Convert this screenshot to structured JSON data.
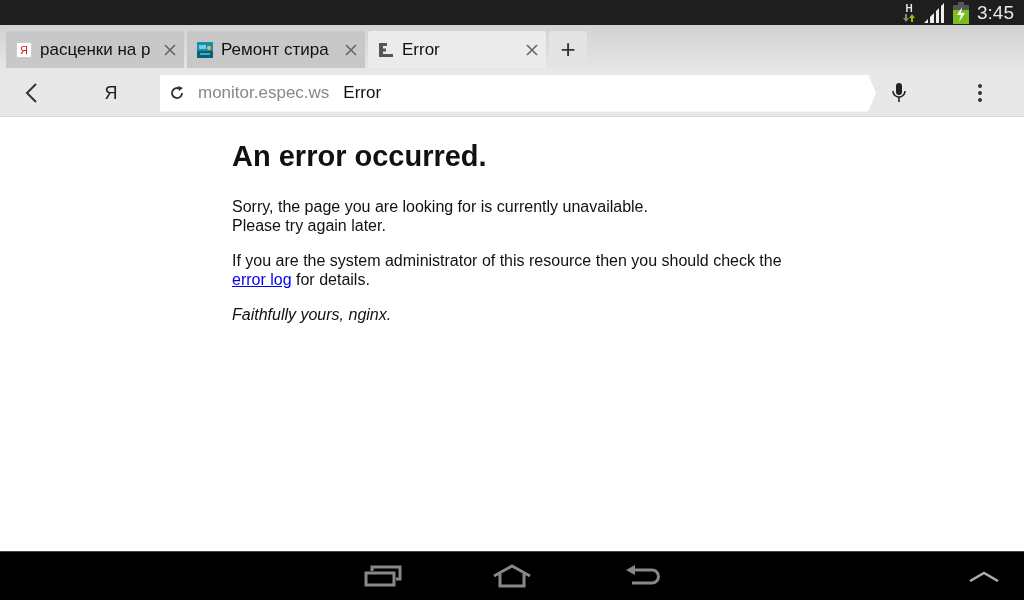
{
  "status_bar": {
    "network": "H",
    "time": "3:45"
  },
  "tabs": [
    {
      "label": "расценки на р",
      "kind": "letter",
      "icon_text": "Я",
      "selected": false
    },
    {
      "label": "Ремонт стира",
      "kind": "picture",
      "selected": false
    },
    {
      "label": "Error",
      "kind": "logo",
      "selected": true
    }
  ],
  "new_tab": "+",
  "toolbar": {
    "search_letter": "Я",
    "url": "monitor.espec.ws",
    "page_title": "Error"
  },
  "page": {
    "heading": "An error occurred.",
    "paragraph_1": "Sorry, the page you are looking for is currently unavailable.\nPlease try again later.",
    "paragraph_2": {
      "before": "If you are the system administrator of this resource then you should check the",
      "link": "error log",
      "after": " for details."
    },
    "signature": "Faithfully yours, nginx."
  }
}
